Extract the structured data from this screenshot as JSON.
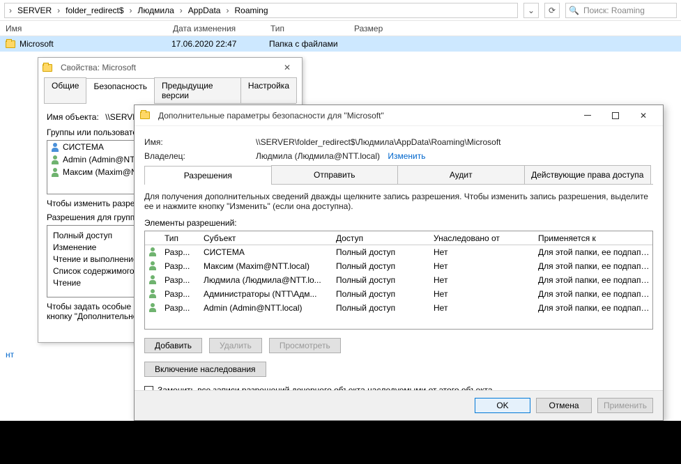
{
  "explorer": {
    "crumbs": [
      "SERVER",
      "folder_redirect$",
      "Людмила",
      "AppData",
      "Roaming"
    ],
    "refresh_glyph": "⟳",
    "dropdown_glyph": "⌄",
    "search_placeholder": "Поиск: Roaming",
    "search_glyph": "🔍",
    "columns": {
      "name": "Имя",
      "date": "Дата изменения",
      "type": "Тип",
      "size": "Размер"
    },
    "row": {
      "name": "Microsoft",
      "date": "17.06.2020 22:47",
      "type": "Папка с файлами",
      "size": ""
    },
    "footer_link": "нт"
  },
  "props": {
    "title": "Свойства: Microsoft",
    "close": "✕",
    "tabs": [
      "Общие",
      "Безопасность",
      "Предыдущие версии",
      "Настройка"
    ],
    "object_label": "Имя объекта:",
    "object_value": "\\\\SERVER\\folder_redirect$\\Людмила\\AppData\\...",
    "groups_label": "Группы или пользователи:",
    "groups": [
      "СИСТЕМА",
      "Admin (Admin@NTT...",
      "Максим (Maxim@N..."
    ],
    "hint1": "Чтобы изменить разрешения, нажмите кнопку \"Изменить\".",
    "perm_label": "Разрешения для группы",
    "perms": [
      "Полный доступ",
      "Изменение",
      "Чтение и выполнение",
      "Список содержимого",
      "Чтение"
    ],
    "hint2": "Чтобы задать особые разрешения или параметры, нажмите кнопку \"Дополнительно\"."
  },
  "adv": {
    "title": "Дополнительные параметры безопасности для \"Microsoft\"",
    "close": "✕",
    "name_label": "Имя:",
    "name_value": "\\\\SERVER\\folder_redirect$\\Людмила\\AppData\\Roaming\\Microsoft",
    "owner_label": "Владелец:",
    "owner_value": "Людмила (Людмила@NTT.local)",
    "change_link": "Изменить",
    "tabs": [
      "Разрешения",
      "Отправить",
      "Аудит",
      "Действующие права доступа"
    ],
    "info": "Для получения дополнительных сведений дважды щелкните запись разрешения. Чтобы изменить запись разрешения, выделите ее и нажмите кнопку \"Изменить\" (если она доступна).",
    "elem_label": "Элементы разрешений:",
    "head": {
      "type": "Тип",
      "subj": "Субъект",
      "acc": "Доступ",
      "inh": "Унаследовано от",
      "app": "Применяется к"
    },
    "rows": [
      {
        "type": "Разр...",
        "subj": "СИСТЕМА",
        "acc": "Полный доступ",
        "inh": "Нет",
        "app": "Для этой папки, ее подпапок ..."
      },
      {
        "type": "Разр...",
        "subj": "Максим (Maxim@NTT.local)",
        "acc": "Полный доступ",
        "inh": "Нет",
        "app": "Для этой папки, ее подпапок ..."
      },
      {
        "type": "Разр...",
        "subj": "Людмила (Людмила@NTT.lo...",
        "acc": "Полный доступ",
        "inh": "Нет",
        "app": "Для этой папки, ее подпапок ..."
      },
      {
        "type": "Разр...",
        "subj": "Администраторы (NTT\\Адм...",
        "acc": "Полный доступ",
        "inh": "Нет",
        "app": "Для этой папки, ее подпапок ..."
      },
      {
        "type": "Разр...",
        "subj": "Admin (Admin@NTT.local)",
        "acc": "Полный доступ",
        "inh": "Нет",
        "app": "Для этой папки, ее подпапок ..."
      }
    ],
    "btn_add": "Добавить",
    "btn_del": "Удалить",
    "btn_view": "Просмотреть",
    "btn_inh": "Включение наследования",
    "chk_replace": "Заменить все записи разрешений дочернего объекта наследуемыми от этого объекта",
    "btn_ok": "OK",
    "btn_cancel": "Отмена",
    "btn_apply": "Применить"
  }
}
